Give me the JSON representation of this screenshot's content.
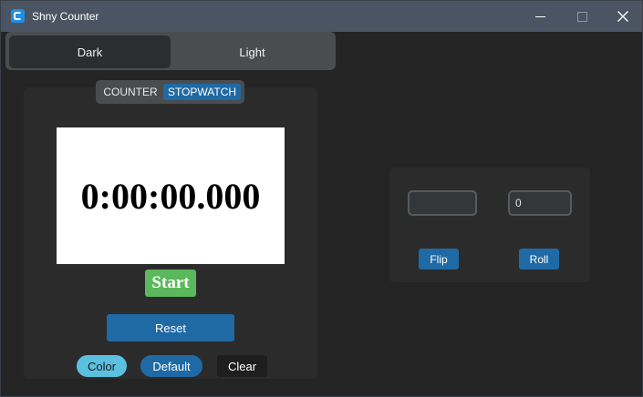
{
  "window": {
    "title": "Shny Counter",
    "app_icon": "app-logo-icon",
    "controls": [
      "minimize-icon",
      "maximize-icon",
      "close-icon"
    ]
  },
  "theme_switch": {
    "options": [
      "Dark",
      "Light"
    ],
    "selected": "Dark"
  },
  "mode_switch": {
    "options": [
      "COUNTER",
      "STOPWATCH"
    ],
    "selected": "STOPWATCH"
  },
  "stopwatch": {
    "display": "0:00:00.000",
    "start_label": "Start",
    "reset_label": "Reset"
  },
  "bottom_buttons": {
    "color_label": "Color",
    "default_label": "Default",
    "clear_label": "Clear"
  },
  "tools": {
    "flip_value": "",
    "roll_value": "0",
    "flip_label": "Flip",
    "roll_label": "Roll"
  },
  "colors": {
    "background": "#242424",
    "titlebar": "#4a5462",
    "accent_blue": "#1f6aa5",
    "start_green": "#5cb85c",
    "color_button": "#5bc0de",
    "panel": "#2b2b2b"
  }
}
